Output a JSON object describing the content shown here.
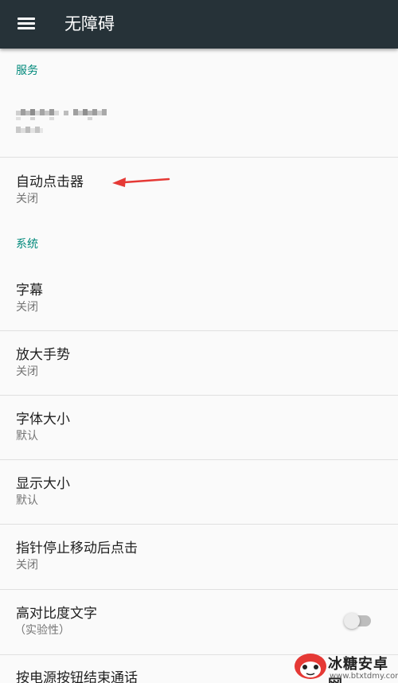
{
  "toolbar": {
    "title": "无障碍",
    "menu_icon": "hamburger-menu-icon"
  },
  "sections": {
    "services_header": "服务",
    "system_header": "系统"
  },
  "services": {
    "auto_clicker": {
      "title": "自动点击器",
      "subtitle": "关闭"
    }
  },
  "system": {
    "captions": {
      "title": "字幕",
      "subtitle": "关闭"
    },
    "magnification": {
      "title": "放大手势",
      "subtitle": "关闭"
    },
    "font_size": {
      "title": "字体大小",
      "subtitle": "默认"
    },
    "display_size": {
      "title": "显示大小",
      "subtitle": "默认"
    },
    "dwell_click": {
      "title": "指针停止移动后点击",
      "subtitle": "关闭"
    },
    "high_contrast": {
      "title": "高对比度文字",
      "subtitle": "（实验性）",
      "enabled": false
    },
    "power_ends_call": {
      "title": "按电源按钮结束通话"
    }
  },
  "watermark": {
    "text": "冰糖安卓网",
    "url": "www.btxtdmy.com"
  },
  "colors": {
    "toolbar": "#263238",
    "accent": "#00897b",
    "arrow": "#e53935"
  }
}
